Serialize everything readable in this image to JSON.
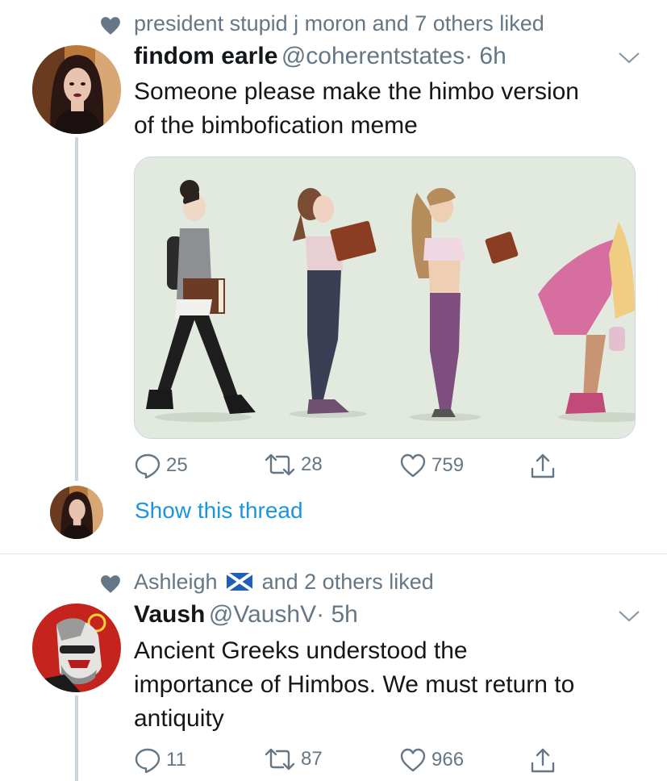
{
  "tweet1": {
    "social_context": "president stupid j moron and 7 others liked",
    "display_name": "findom earle",
    "handle": "@coherentstates",
    "time": "· 6h",
    "text_line1": "Someone please make the himbo version",
    "text_line2": "of the bimbofication meme",
    "replies": "25",
    "retweets": "28",
    "likes": "759",
    "show_thread": "Show this thread"
  },
  "tweet2": {
    "social_context_name": "Ashleigh",
    "social_context_flag": "scotland-flag-icon",
    "social_context_rest": "and 2 others liked",
    "display_name": "Vaush",
    "handle": "@VaushV",
    "time": "· 5h",
    "text_line1": "Ancient Greeks understood the",
    "text_line2": "importance of Himbos. We must return to",
    "text_line3": "antiquity",
    "replies": "11",
    "retweets": "87",
    "likes": "966"
  },
  "colors": {
    "secondary_text": "#657786",
    "link": "#1b95e0",
    "thread_line": "#ccd6dd",
    "media_bg": "#e2e9de"
  },
  "icons": [
    "heart-icon",
    "chevron-down-icon",
    "reply-icon",
    "retweet-icon",
    "like-icon",
    "share-icon",
    "scotland-flag-icon"
  ]
}
